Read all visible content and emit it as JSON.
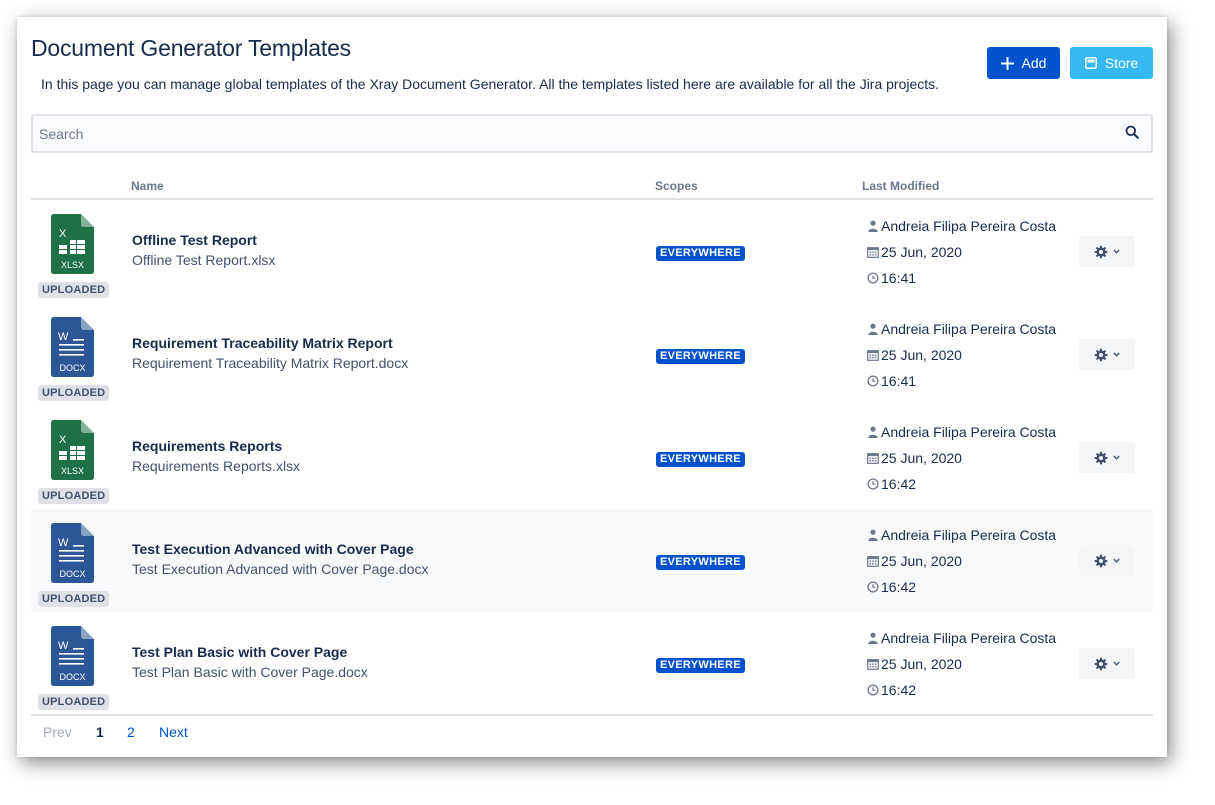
{
  "page": {
    "title": "Document Generator Templates",
    "description": "In this page you can manage global templates of the Xray Document Generator. All the templates listed here are available for all the Jira projects."
  },
  "toolbar": {
    "add_label": "Add",
    "store_label": "Store"
  },
  "search": {
    "placeholder": "Search",
    "icon": "search-icon"
  },
  "table": {
    "headers": {
      "name": "Name",
      "scopes": "Scopes",
      "last_modified": "Last Modified"
    },
    "rows": [
      {
        "type_label": "XLSX",
        "file_type": "excel",
        "status": "UPLOADED",
        "name": "Offline Test Report",
        "filename": "Offline Test Report.xlsx",
        "scope": "EVERYWHERE",
        "user": "Andreia Filipa Pereira Costa",
        "date": "25 Jun, 2020",
        "time": "16:41"
      },
      {
        "type_label": "DOCX",
        "file_type": "word",
        "status": "UPLOADED",
        "name": "Requirement Traceability Matrix Report",
        "filename": "Requirement Traceability Matrix Report.docx",
        "scope": "EVERYWHERE",
        "user": "Andreia Filipa Pereira Costa",
        "date": "25 Jun, 2020",
        "time": "16:41"
      },
      {
        "type_label": "XLSX",
        "file_type": "excel",
        "status": "UPLOADED",
        "name": "Requirements Reports",
        "filename": "Requirements Reports.xlsx",
        "scope": "EVERYWHERE",
        "user": "Andreia Filipa Pereira Costa",
        "date": "25 Jun, 2020",
        "time": "16:42"
      },
      {
        "type_label": "DOCX",
        "file_type": "word",
        "status": "UPLOADED",
        "name": "Test Execution Advanced with Cover Page",
        "filename": "Test Execution Advanced with Cover Page.docx",
        "scope": "EVERYWHERE",
        "user": "Andreia Filipa Pereira Costa",
        "date": "25 Jun, 2020",
        "time": "16:42"
      },
      {
        "type_label": "DOCX",
        "file_type": "word",
        "status": "UPLOADED",
        "name": "Test Plan Basic with Cover Page",
        "filename": "Test Plan Basic with Cover Page.docx",
        "scope": "EVERYWHERE",
        "user": "Andreia Filipa Pereira Costa",
        "date": "25 Jun, 2020",
        "time": "16:42"
      }
    ]
  },
  "pagination": {
    "prev": "Prev",
    "pages": [
      "1",
      "2"
    ],
    "current": "1",
    "next": "Next"
  },
  "colors": {
    "primary": "#0052cc",
    "store": "#36b8f3",
    "excel": "#1e7145",
    "word": "#2b5797"
  }
}
